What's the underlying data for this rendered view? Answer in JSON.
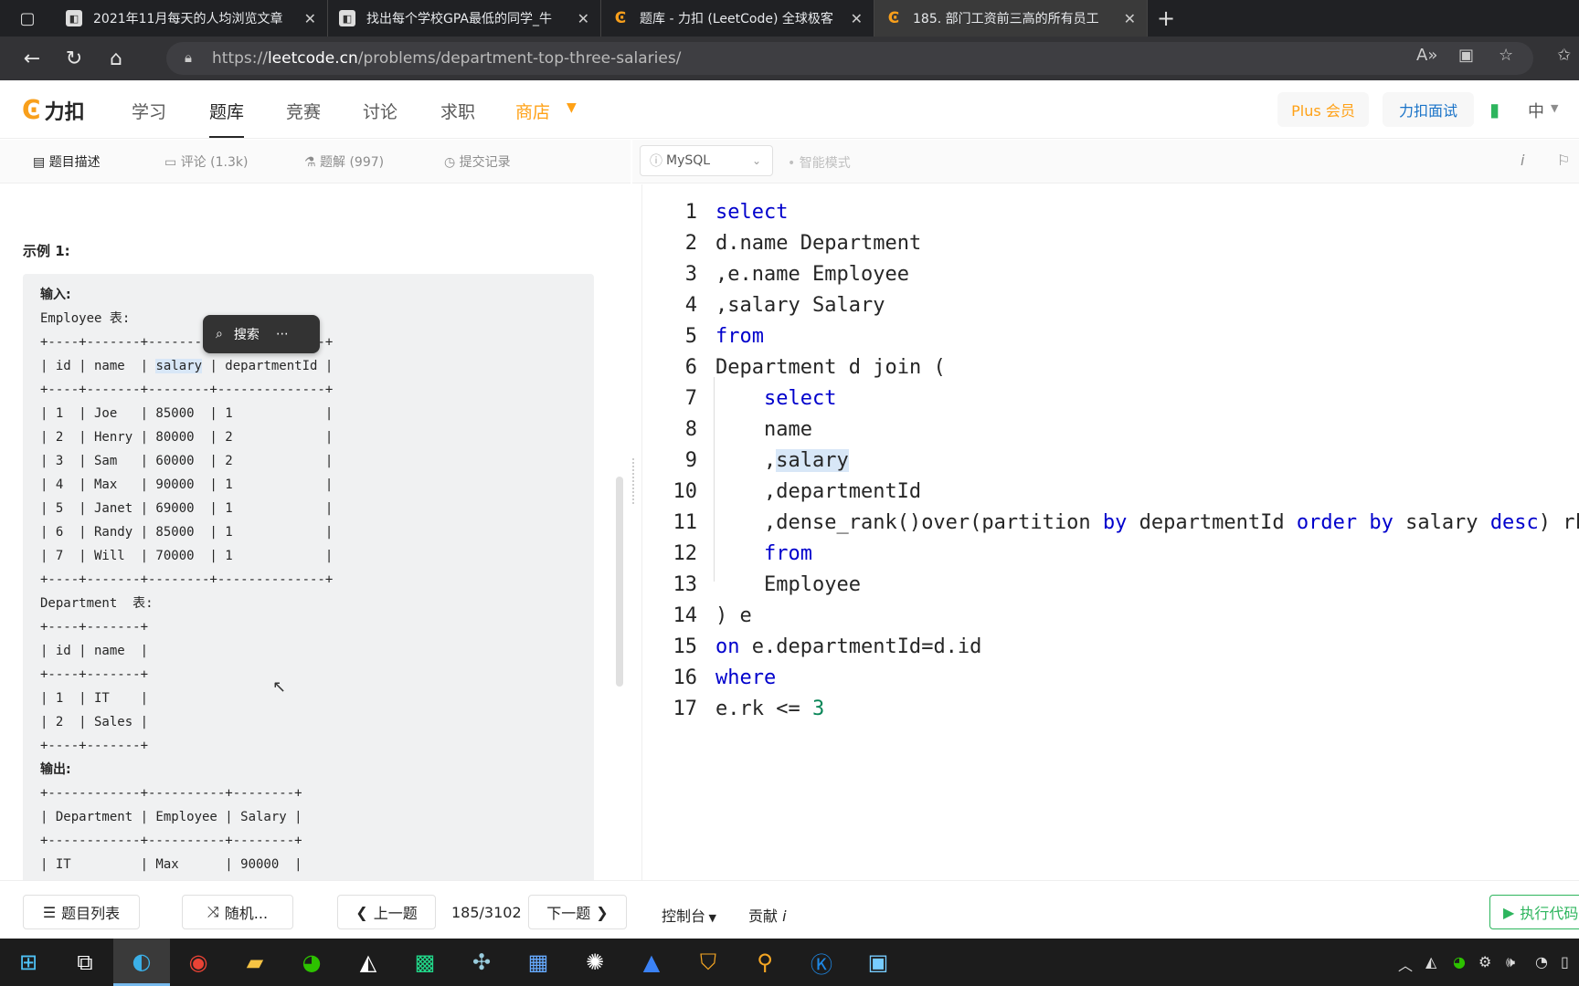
{
  "browser": {
    "tabs": [
      {
        "title": "2021年11月每天的人均浏览文章",
        "active": false
      },
      {
        "title": "找出每个学校GPA最低的同学_牛",
        "active": false
      },
      {
        "title": "题库 - 力扣 (LeetCode) 全球极客",
        "active": false
      },
      {
        "title": "185. 部门工资前三高的所有员工",
        "active": true
      }
    ],
    "url_prefix": "https://",
    "url_domain": "leetcode.cn",
    "url_path": "/problems/department-top-three-salaries/"
  },
  "site": {
    "logo_text": "力扣",
    "nav": [
      "学习",
      "题库",
      "竞赛",
      "讨论",
      "求职",
      "商店"
    ],
    "plus_label": "Plus 会员",
    "interview_label": "力扣面试",
    "lang_label": "中"
  },
  "subtabs": {
    "description": "题目描述",
    "comments": "评论 (1.3k)",
    "solutions": "题解 (997)",
    "submissions": "提交记录"
  },
  "editor_toolbar": {
    "language": "MySQL",
    "smart_mode": "智能模式"
  },
  "problem": {
    "example_title": "示例 1:",
    "popup_search": "搜索",
    "lines": [
      "输入:",
      "Employee 表:",
      "+----+-------+--------+--------------+",
      "| id | name  | salary | departmentId |",
      "+----+-------+--------+--------------+",
      "| 1  | Joe   | 85000  | 1            |",
      "| 2  | Henry | 80000  | 2            |",
      "| 3  | Sam   | 60000  | 2            |",
      "| 4  | Max   | 90000  | 1            |",
      "| 5  | Janet | 69000  | 1            |",
      "| 6  | Randy | 85000  | 1            |",
      "| 7  | Will  | 70000  | 1            |",
      "+----+-------+--------+--------------+",
      "Department  表:",
      "+----+-------+",
      "| id | name  |",
      "+----+-------+",
      "| 1  | IT    |",
      "| 2  | Sales |",
      "+----+-------+",
      "输出:",
      "+------------+----------+--------+",
      "| Department | Employee | Salary |",
      "+------------+----------+--------+",
      "| IT         | Max      | 90000  |"
    ]
  },
  "code": [
    "select",
    "d.name Department",
    ",e.name Employee",
    ",salary Salary",
    "from",
    "Department d join (",
    "    select",
    "    name",
    "    ,salary",
    "    ,departmentId",
    "    ,dense_rank()over(partition by departmentId order by salary desc) rk",
    "    from",
    "    Employee",
    ") e",
    "on e.departmentId=d.id",
    "where",
    "e.rk <= 3"
  ],
  "bottom": {
    "problem_list": "题目列表",
    "random": "随机...",
    "prev": "上一题",
    "page": "185/3102",
    "next": "下一题",
    "console": "控制台",
    "contribute": "贡献",
    "run": "执行代码"
  }
}
